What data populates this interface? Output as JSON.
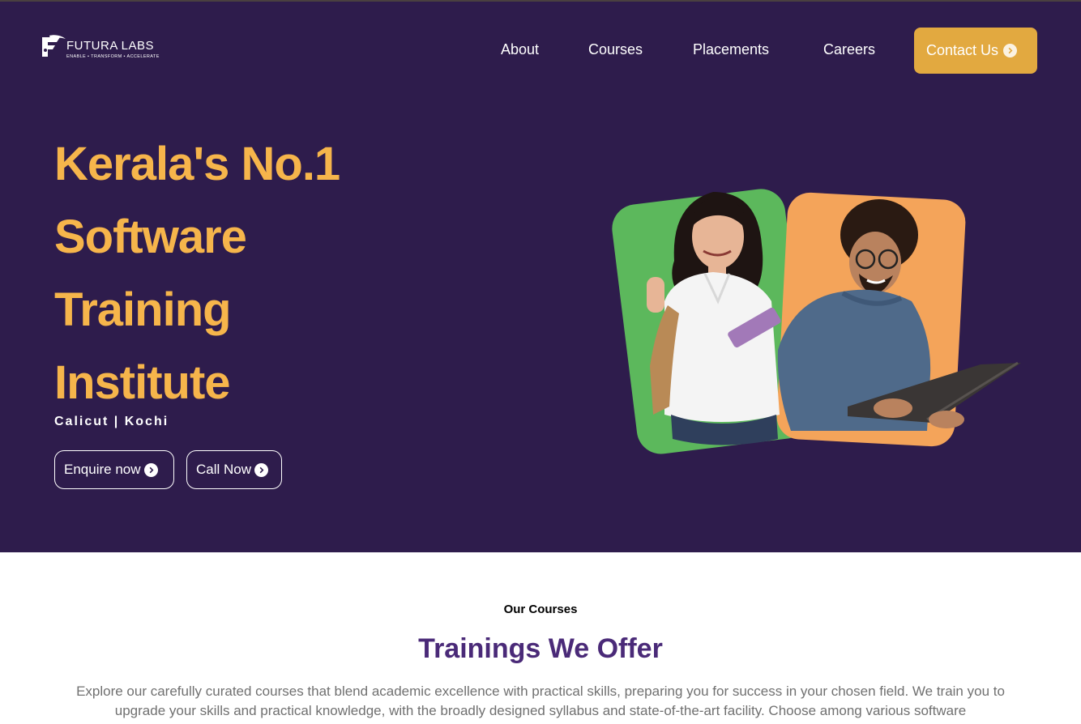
{
  "brand": {
    "name": "FUTURA LABS",
    "tagline": "ENABLE • TRANSFORM • ACCELERATE"
  },
  "nav": {
    "about": "About",
    "courses": "Courses",
    "placements": "Placements",
    "careers": "Careers",
    "contact": "Contact Us"
  },
  "hero": {
    "title_lines": [
      "Kerala's No.1",
      "Software",
      "Training",
      "Institute"
    ],
    "locations": "Calicut | Kochi",
    "enquire_label": "Enquire now",
    "call_label": "Call Now"
  },
  "courses_section": {
    "eyebrow": "Our Courses",
    "title": "Trainings We Offer",
    "description": "Explore our carefully curated courses that blend academic excellence with practical skills, preparing you for success in your chosen field. We train you to upgrade your skills and practical knowledge, with the broadly designed syllabus and state-of-the-art facility. Choose among various software"
  },
  "colors": {
    "hero_bg": "#2e1c4c",
    "accent_gold": "#f6b54b",
    "contact_button": "#e2a940",
    "section_title": "#4a2a78",
    "card_green": "#5cb85c",
    "card_orange": "#f4a45a"
  },
  "icons": {
    "arrow": "chevron-right-circle-icon",
    "sparkle": "sparkle-icon"
  }
}
